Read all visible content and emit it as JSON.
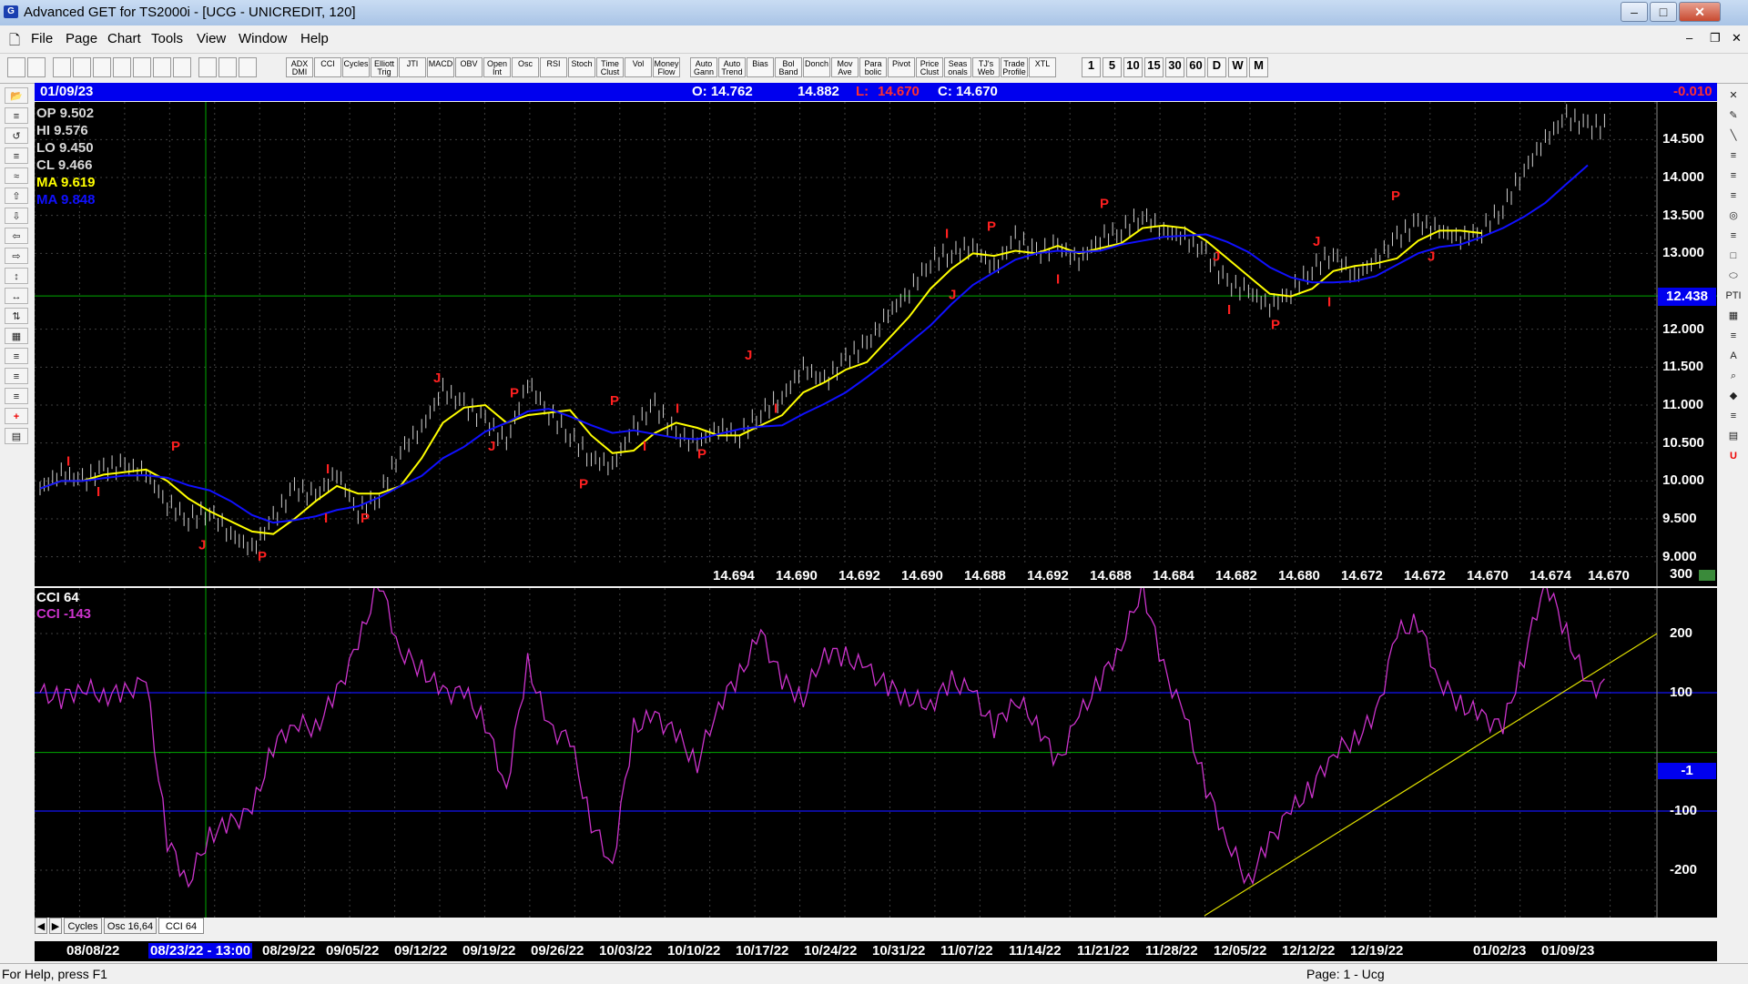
{
  "window": {
    "title": "Advanced GET for TS2000i - [UCG - UNICREDIT, 120]",
    "min": "–",
    "max": "□",
    "close": "✕"
  },
  "menu": [
    "File",
    "Page",
    "Chart",
    "Tools",
    "View",
    "Window",
    "Help"
  ],
  "toolbar": {
    "buttons": [
      "ADX DMI",
      "CCI",
      "Cycles",
      "Elliott Trig",
      "JTI",
      "MACD",
      "OBV",
      "Open Int",
      "Osc",
      "RSI",
      "Stoch",
      "Time Clust",
      "Vol",
      "Money Flow",
      "Auto Gann",
      "Auto Trend",
      "Bias",
      "Bol Band",
      "Donch",
      "Mov Ave",
      "Para bolic",
      "Pivot",
      "Price Clust",
      "Seas onals",
      "TJ's Web",
      "Trade Profile",
      "XTL"
    ],
    "periods": [
      "1",
      "5",
      "10",
      "15",
      "30",
      "60",
      "D",
      "W",
      "M"
    ]
  },
  "info": {
    "date": "01/09/23",
    "open": "O: 14.762",
    "high": "14.882",
    "low_label": "L:",
    "low": "14.670",
    "close": "C: 14.670",
    "change": "-0.010"
  },
  "legend": {
    "op": "OP 9.502",
    "hi": "HI  9.576",
    "lo": "LO  9.450",
    "cl": "CL  9.466",
    "ma1": "MA  9.619",
    "ma2": "MA  9.848"
  },
  "price_axis": [
    "14.500",
    "14.000",
    "13.500",
    "13.000",
    "12.000",
    "11.500",
    "11.000",
    "10.500",
    "10.000",
    "9.500",
    "9.000"
  ],
  "current_price": "12.438",
  "bottom_values": [
    "14.694",
    "14.690",
    "14.692",
    "14.690",
    "14.688",
    "14.692",
    "14.688",
    "14.684",
    "14.682",
    "14.680",
    "14.672",
    "14.672",
    "14.670",
    "14.674"
  ],
  "last_value": "14.670",
  "cci_legend": {
    "title": "CCI 64",
    "value": "CCI  -143"
  },
  "cci_axis": [
    "300",
    "200",
    "100",
    "-100",
    "-200"
  ],
  "cci_current": "-1",
  "tabs": [
    "Cycles",
    "Osc 16,64",
    "CCI 64"
  ],
  "dates": [
    "08/08/22",
    "08/23/22 - 13:00",
    "08/29/22",
    "09/05/22",
    "09/12/22",
    "09/19/22",
    "09/26/22",
    "10/03/22",
    "10/10/22",
    "10/17/22",
    "10/24/22",
    "10/31/22",
    "11/07/22",
    "11/14/22",
    "11/21/22",
    "11/28/22",
    "12/05/22",
    "12/12/22",
    "12/19/22",
    "01/02/23",
    "01/09/23"
  ],
  "status": {
    "help": "For Help, press F1",
    "page": "Page: 1 - Ucg"
  },
  "colors": {
    "ma_fast": "#ffff00",
    "ma_slow": "#1010ff",
    "cci": "#cc33cc",
    "pivot": "#ff2020",
    "bars": "#d0d0d0"
  },
  "chart_data": {
    "type": "line",
    "ylim": [
      8.9,
      14.9
    ],
    "price_close": [
      9.9,
      10.1,
      10.0,
      10.15,
      10.2,
      10.1,
      9.7,
      9.5,
      9.6,
      9.3,
      9.1,
      9.5,
      9.9,
      9.8,
      10.1,
      9.6,
      9.8,
      10.4,
      10.7,
      11.2,
      11.0,
      10.8,
      10.5,
      11.3,
      10.9,
      10.6,
      10.3,
      10.2,
      10.7,
      11.0,
      10.6,
      10.5,
      10.7,
      10.6,
      10.9,
      11.1,
      11.5,
      11.3,
      11.6,
      11.8,
      12.2,
      12.5,
      12.9,
      13.0,
      13.1,
      12.8,
      13.2,
      13.0,
      13.1,
      12.9,
      13.2,
      13.3,
      13.5,
      13.3,
      13.2,
      13.0,
      12.6,
      12.5,
      12.3,
      12.5,
      12.8,
      13.0,
      12.7,
      12.9,
      13.2,
      13.4,
      13.3,
      13.2,
      13.3,
      13.6,
      14.1,
      14.5,
      14.8,
      14.67
    ],
    "cci": [
      100,
      90,
      110,
      95,
      100,
      120,
      -150,
      -220,
      -140,
      -120,
      -100,
      10,
      50,
      40,
      100,
      180,
      290,
      170,
      140,
      100,
      100,
      50,
      -60,
      150,
      40,
      20,
      -120,
      -190,
      40,
      60,
      30,
      -20,
      80,
      130,
      200,
      120,
      90,
      170,
      160,
      140,
      110,
      90,
      80,
      120,
      100,
      40,
      90,
      50,
      -20,
      60,
      120,
      180,
      280,
      140,
      60,
      -60,
      -150,
      -220,
      -150,
      -100,
      -60,
      0,
      20,
      60,
      200,
      220,
      120,
      80,
      60,
      40,
      160,
      290,
      200,
      110
    ]
  }
}
